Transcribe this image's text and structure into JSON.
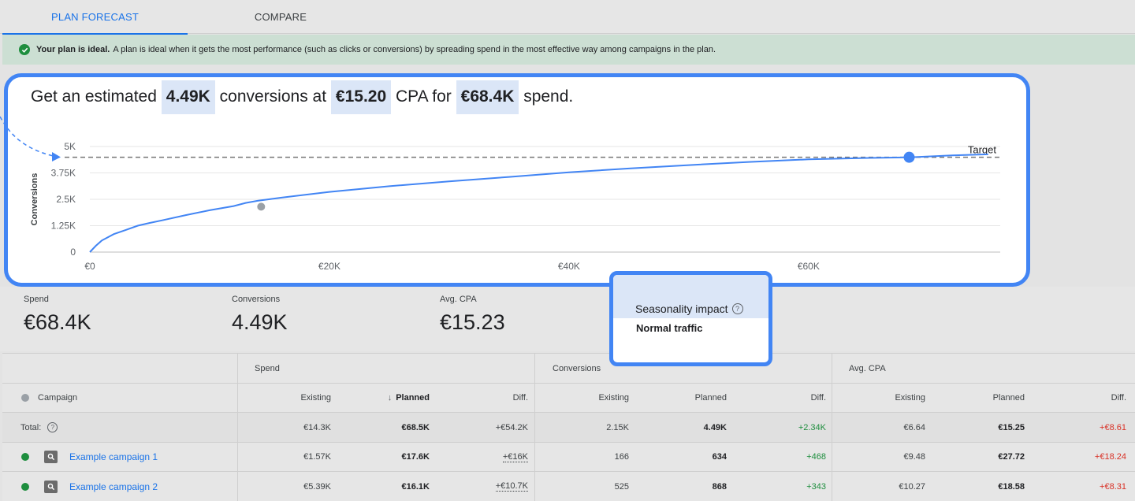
{
  "tabs": [
    {
      "label": "PLAN FORECAST",
      "active": true
    },
    {
      "label": "COMPARE",
      "active": false
    }
  ],
  "banner": {
    "icon": "check-circle-icon",
    "bold": "Your plan is ideal.",
    "text": "A plan is ideal when it gets the most performance (such as clicks or conversions) by spreading spend in the most effective way among campaigns in the plan."
  },
  "headline": {
    "part1": "Get an estimated",
    "conversions": "4.49K",
    "part2": "conversions at",
    "cpa": "€15.20",
    "part3": "CPA for",
    "spend": "€68.4K",
    "part4": "spend."
  },
  "chart_data": {
    "type": "line",
    "title": "",
    "xlabel": "",
    "ylabel": "Conversions",
    "x_ticks": [
      "€0",
      "€20K",
      "€40K",
      "€60K"
    ],
    "y_ticks": [
      "0",
      "1.25K",
      "2.5K",
      "3.75K",
      "5K"
    ],
    "xlim": [
      0,
      76000
    ],
    "ylim": [
      0,
      5000
    ],
    "target_label": "Target",
    "target_value": 4490,
    "grid": true,
    "series": [
      {
        "values_x": [
          0,
          500,
          1000,
          1500,
          2000,
          3000,
          4000,
          5000,
          6000,
          8000,
          10000,
          12000,
          13000,
          14000,
          16000,
          20000,
          25000,
          30000,
          35000,
          40000,
          45000,
          50000,
          55000,
          60000,
          65000,
          68400,
          72000,
          75000
        ],
        "values_y": [
          0,
          300,
          550,
          700,
          850,
          1050,
          1250,
          1380,
          1500,
          1750,
          1980,
          2180,
          2330,
          2430,
          2580,
          2850,
          3120,
          3350,
          3560,
          3780,
          3960,
          4120,
          4270,
          4390,
          4460,
          4490,
          4580,
          4630
        ]
      }
    ],
    "points": [
      {
        "name": "existing",
        "x": 14300,
        "y": 2150,
        "color": "#9aa0a6"
      },
      {
        "name": "planned",
        "x": 68400,
        "y": 4490,
        "color": "#4285f4"
      }
    ]
  },
  "metrics": [
    {
      "label": "Spend",
      "value": "€68.4K"
    },
    {
      "label": "Conversions",
      "value": "4.49K"
    },
    {
      "label": "Avg. CPA",
      "value": "€15.23"
    }
  ],
  "seasonality": {
    "label": "Seasonality impact",
    "help_icon": "help-circle-icon",
    "value": "Normal traffic"
  },
  "table": {
    "groups": [
      "Spend",
      "Conversions",
      "Avg. CPA"
    ],
    "campaign_header": "Campaign",
    "sort_icon": "arrow-down-icon",
    "subheaders": [
      "Existing",
      "Planned",
      "Diff.",
      "Existing",
      "Planned",
      "Diff.",
      "Existing",
      "Planned",
      "Diff."
    ],
    "total": {
      "label": "Total:",
      "cells": [
        "€14.3K",
        "€68.5K",
        "+€54.2K",
        "2.15K",
        "4.49K",
        "+2.34K",
        "€6.64",
        "€15.25",
        "+€8.61"
      ]
    },
    "rows": [
      {
        "name": "Example campaign 1",
        "status_color": "#1e8e3e",
        "cells": [
          "€1.57K",
          "€17.6K",
          "+€16K",
          "166",
          "634",
          "+468",
          "€9.48",
          "€27.72",
          "+€18.24"
        ]
      },
      {
        "name": "Example campaign 2",
        "status_color": "#1e8e3e",
        "cells": [
          "€5.39K",
          "€16.1K",
          "+€10.7K",
          "525",
          "868",
          "+343",
          "€10.27",
          "€18.58",
          "+€8.31"
        ]
      }
    ]
  }
}
